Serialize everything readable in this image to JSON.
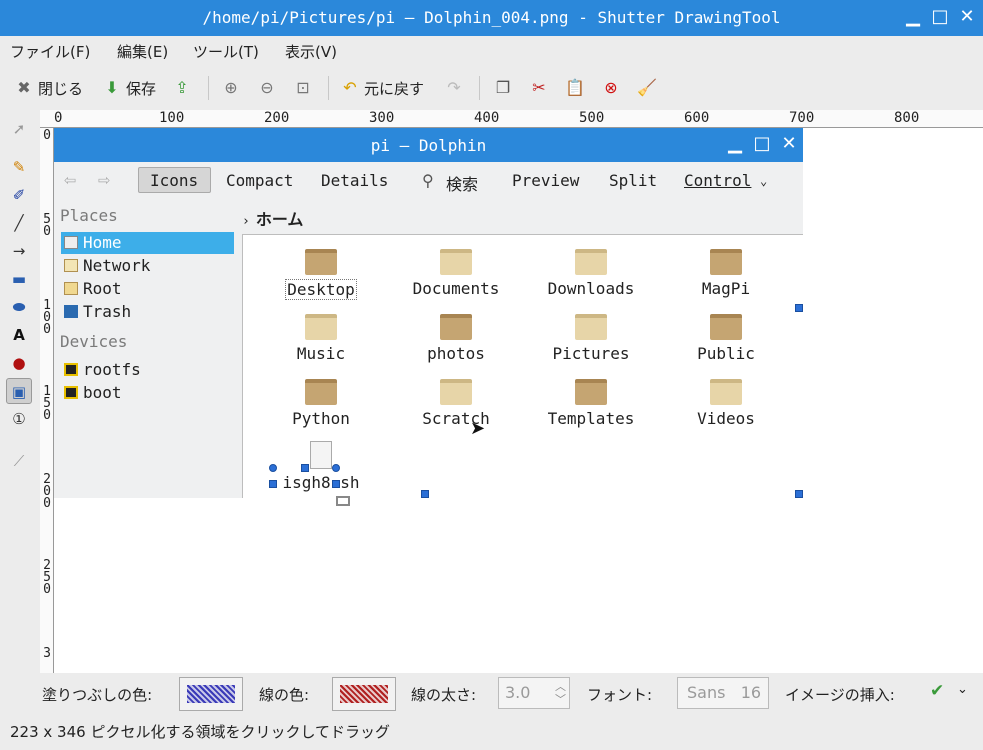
{
  "window": {
    "title": "/home/pi/Pictures/pi — Dolphin_004.png - Shutter DrawingTool",
    "minimize_label": "▁",
    "maximize_label": "□",
    "close_label": "✕"
  },
  "menu": [
    "ファイル(F)",
    "編集(E)",
    "ツール(T)",
    "表示(V)"
  ],
  "toolbar": {
    "close_label": "閉じる",
    "save_label": "保存",
    "undo_label": "元に戻す"
  },
  "ruler_h": [
    "0",
    "100",
    "200",
    "300",
    "400",
    "500",
    "600",
    "700",
    "800"
  ],
  "ruler_v": [
    "0",
    "5\n0",
    "1\n0\n0",
    "1\n5\n0",
    "2\n0\n0",
    "2\n5\n0",
    "3"
  ],
  "dolphin": {
    "title": "pi — Dolphin",
    "toolbar": {
      "icons": "Icons",
      "compact": "Compact",
      "details": "Details",
      "search": "検索",
      "preview": "Preview",
      "split": "Split",
      "control": "Control"
    },
    "places_header": "Places",
    "places": [
      "Home",
      "Network",
      "Root",
      "Trash"
    ],
    "devices_header": "Devices",
    "devices": [
      "rootfs",
      "boot"
    ],
    "breadcrumb": "ホーム",
    "files": [
      "Desktop",
      "Documents",
      "Downloads",
      "MagPi",
      "Music",
      "photos",
      "Pictures",
      "Public",
      "Python",
      "Scratch",
      "Templates",
      "Videos",
      "isgh8.sh"
    ]
  },
  "bottom": {
    "fill_label": "塗りつぶしの色:",
    "stroke_label": "線の色:",
    "width_label": "線の太さ:",
    "width_value": "3.0",
    "font_label": "フォント:",
    "font_value": "Sans   16",
    "insert_label": "イメージの挿入:",
    "fill_color": "#3a3ab8",
    "stroke_color": "#b02020"
  },
  "status_message": "223 x 346 ピクセル化する領域をクリックしてドラッグ"
}
